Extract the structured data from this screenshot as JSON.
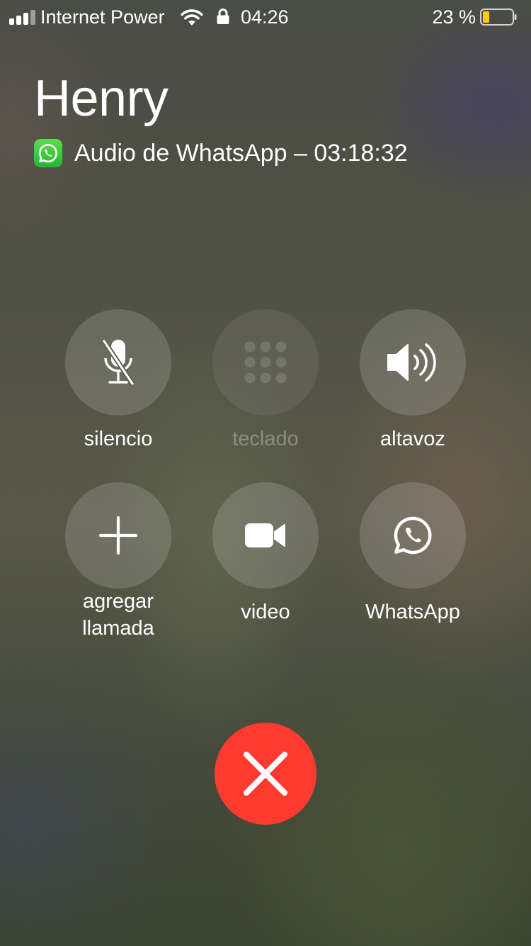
{
  "status_bar": {
    "carrier": "Internet Power",
    "time": "04:26",
    "battery_percent": "23 %",
    "battery_level": 0.23,
    "battery_color": "#ffcc00",
    "signal_bars": 3,
    "signal_max": 4
  },
  "caller": {
    "name": "Henry",
    "call_info": "Audio de WhatsApp – 03:18:32",
    "app_icon": "whatsapp-icon",
    "app_icon_color": "#25d366"
  },
  "controls": {
    "mute": {
      "label": "silencio",
      "icon": "mic-off-icon"
    },
    "keypad": {
      "label": "teclado",
      "icon": "keypad-icon",
      "enabled": false
    },
    "speaker": {
      "label": "altavoz",
      "icon": "speaker-icon"
    },
    "add_call": {
      "label_line1": "agregar",
      "label_line2": "llamada",
      "icon": "plus-icon"
    },
    "video": {
      "label": "video",
      "icon": "video-camera-icon"
    },
    "whatsapp": {
      "label": "WhatsApp",
      "icon": "whatsapp-icon"
    }
  },
  "end_call": {
    "icon": "close-icon",
    "color": "#ff3b30"
  }
}
